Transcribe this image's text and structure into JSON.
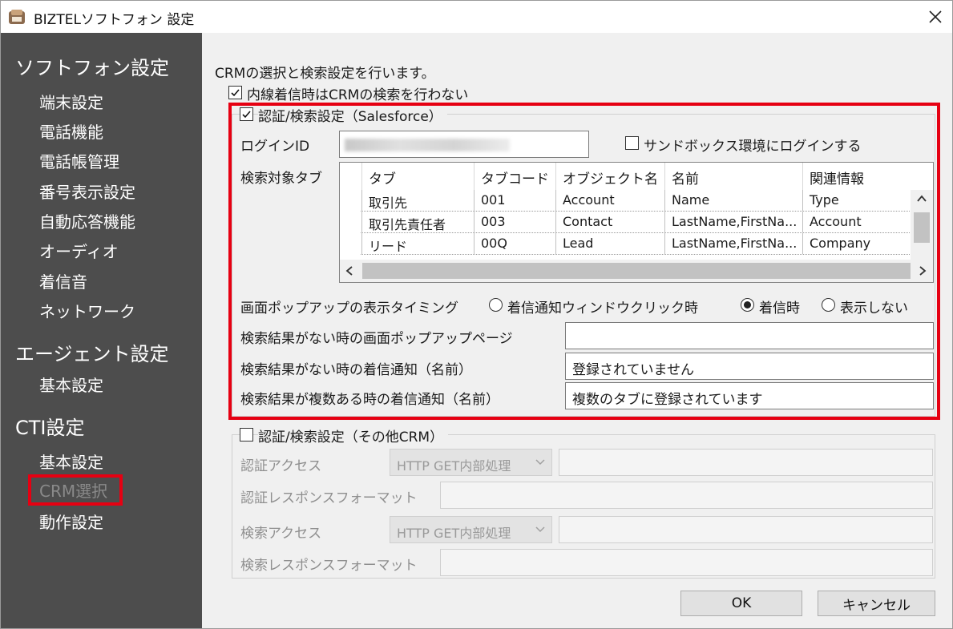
{
  "window": {
    "title": "BIZTELソフトフォン 設定",
    "close_icon": "×"
  },
  "sidebar": {
    "sections": [
      {
        "heading": "ソフトフォン設定",
        "items": [
          "端末設定",
          "電話機能",
          "電話帳管理",
          "番号表示設定",
          "自動応答機能",
          "オーディオ",
          "着信音",
          "ネットワーク"
        ]
      },
      {
        "heading": "エージェント設定",
        "items": [
          "基本設定"
        ]
      },
      {
        "heading": "CTI設定",
        "items": [
          "基本設定",
          "CRM選択",
          "動作設定"
        ]
      }
    ],
    "active_item": "CRM選択"
  },
  "content": {
    "intro": "CRMの選択と検索設定を行います。",
    "skip_search_label": "内線着信時はCRMの検索を行わない",
    "skip_search_checked": true,
    "salesforce": {
      "group_label": "認証/検索設定（Salesforce）",
      "checked": true,
      "login_id_label": "ログインID",
      "sandbox_label": "サンドボックス環境にログインする",
      "sandbox_checked": false,
      "search_tab_label": "検索対象タブ",
      "table": {
        "columns": [
          "タブ",
          "タブコード",
          "オブジェクト名",
          "名前",
          "関連情報"
        ],
        "rows": [
          [
            "取引先",
            "001",
            "Account",
            "Name",
            "Type"
          ],
          [
            "取引先責任者",
            "003",
            "Contact",
            "LastName,FirstNa...",
            "Account"
          ],
          [
            "リード",
            "00Q",
            "Lead",
            "LastName,FirstNa...",
            "Company"
          ]
        ]
      },
      "popup_timing_label": "画面ポップアップの表示タイミング",
      "popup_options": [
        "着信通知ウィンドウクリック時",
        "着信時",
        "表示しない"
      ],
      "popup_selected": "着信時",
      "no_result_page_label": "検索結果がない時の画面ポップアップページ",
      "no_result_page_value": "",
      "no_result_notice_label": "検索結果がない時の着信通知（名前）",
      "no_result_notice_value": "登録されていません",
      "multi_result_notice_label": "検索結果が複数ある時の着信通知（名前）",
      "multi_result_notice_value": "複数のタブに登録されています"
    },
    "other_crm": {
      "group_label": "認証/検索設定（その他CRM）",
      "checked": false,
      "auth_access_label": "認証アクセス",
      "auth_access_method": "HTTP GET内部処理",
      "auth_response_label": "認証レスポンスフォーマット",
      "search_access_label": "検索アクセス",
      "search_access_method": "HTTP GET内部処理",
      "search_response_label": "検索レスポンスフォーマット"
    },
    "buttons": {
      "ok": "OK",
      "cancel": "キャンセル"
    }
  },
  "colors": {
    "sidebar_bg": "#4d4d4d",
    "highlight": "#e60012",
    "content_bg": "#f0f0f0"
  },
  "icons": [
    "app-icon",
    "close-icon",
    "checkbox-checked-icon",
    "checkbox-empty-icon",
    "radio-selected-icon",
    "chevron-down-icon",
    "scroll-up-icon",
    "scroll-left-icon",
    "scroll-right-icon"
  ]
}
